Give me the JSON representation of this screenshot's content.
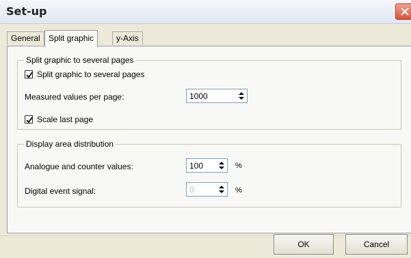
{
  "window": {
    "title": "Set-up"
  },
  "tabs": [
    {
      "label": "General"
    },
    {
      "label": "Split graphic"
    },
    {
      "label": "y-Axis"
    }
  ],
  "split_group": {
    "title": "Split graphic to several pages",
    "split_checkbox": {
      "label": "Split graphic to several pages",
      "checked": true
    },
    "measured_values": {
      "label": "Measured values per page:",
      "value": "1000"
    },
    "scale_checkbox": {
      "label": "Scale last page",
      "checked": true
    }
  },
  "display_group": {
    "title": "Display area distribution",
    "analogue": {
      "label": "Analogue and counter values:",
      "value": "100",
      "unit": "%"
    },
    "digital": {
      "label": "Digital event signal:",
      "value": "0",
      "unit": "%"
    }
  },
  "buttons": {
    "ok": "OK",
    "cancel": "Cancel"
  }
}
